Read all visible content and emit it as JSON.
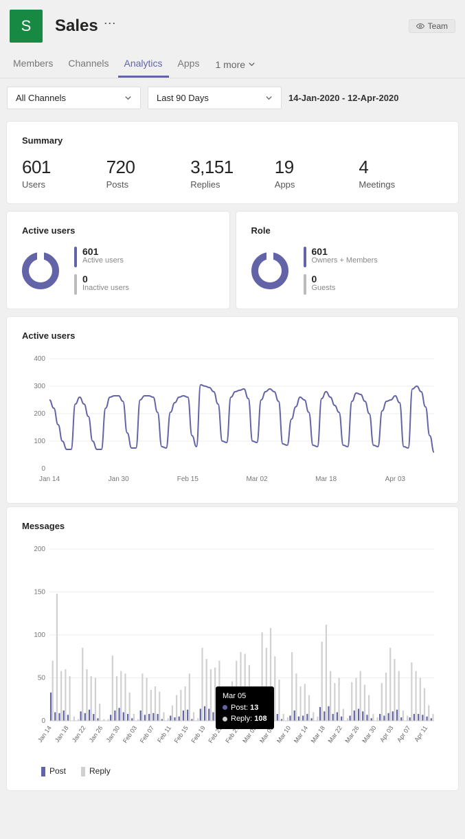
{
  "header": {
    "badge_letter": "S",
    "title": "Sales",
    "team_chip": "Team"
  },
  "tabs": {
    "items": [
      "Members",
      "Channels",
      "Analytics",
      "Apps"
    ],
    "active_index": 2,
    "more_label": "1 more"
  },
  "filters": {
    "channel_dropdown": "All Channels",
    "range_dropdown": "Last 90 Days",
    "date_range_text": "14-Jan-2020 - 12-Apr-2020"
  },
  "summary": {
    "title": "Summary",
    "stats": [
      {
        "value": "601",
        "label": "Users"
      },
      {
        "value": "720",
        "label": "Posts"
      },
      {
        "value": "3,151",
        "label": "Replies"
      },
      {
        "value": "19",
        "label": "Apps"
      },
      {
        "value": "4",
        "label": "Meetings"
      }
    ]
  },
  "active_users_card": {
    "title": "Active users",
    "primary_value": "601",
    "primary_label": "Active users",
    "secondary_value": "0",
    "secondary_label": "Inactive users"
  },
  "role_card": {
    "title": "Role",
    "primary_value": "601",
    "primary_label": "Owners + Members",
    "secondary_value": "0",
    "secondary_label": "Guests"
  },
  "active_users_chart_title": "Active users",
  "messages_chart_title": "Messages",
  "messages_legend": {
    "post": "Post",
    "reply": "Reply"
  },
  "tooltip": {
    "date": "Mar 05",
    "post_label": "Post",
    "post_value": "13",
    "reply_label": "Reply",
    "reply_value": "108"
  },
  "chart_data": [
    {
      "type": "line",
      "title": "Active users",
      "xlabel": "",
      "ylabel": "",
      "ylim": [
        0,
        400
      ],
      "x_tick_labels": [
        "Jan 14",
        "Jan 30",
        "Feb 15",
        "Mar 02",
        "Mar 18",
        "Apr 03"
      ],
      "x": [
        "Jan 14",
        "Jan 15",
        "Jan 16",
        "Jan 17",
        "Jan 18",
        "Jan 19",
        "Jan 20",
        "Jan 21",
        "Jan 22",
        "Jan 23",
        "Jan 24",
        "Jan 25",
        "Jan 26",
        "Jan 27",
        "Jan 28",
        "Jan 29",
        "Jan 30",
        "Jan 31",
        "Feb 01",
        "Feb 02",
        "Feb 03",
        "Feb 04",
        "Feb 05",
        "Feb 06",
        "Feb 07",
        "Feb 08",
        "Feb 09",
        "Feb 10",
        "Feb 11",
        "Feb 12",
        "Feb 13",
        "Feb 14",
        "Feb 15",
        "Feb 16",
        "Feb 17",
        "Feb 18",
        "Feb 19",
        "Feb 20",
        "Feb 21",
        "Feb 22",
        "Feb 23",
        "Feb 24",
        "Feb 25",
        "Feb 26",
        "Feb 27",
        "Feb 28",
        "Feb 29",
        "Mar 01",
        "Mar 02",
        "Mar 03",
        "Mar 04",
        "Mar 05",
        "Mar 06",
        "Mar 07",
        "Mar 08",
        "Mar 09",
        "Mar 10",
        "Mar 11",
        "Mar 12",
        "Mar 13",
        "Mar 14",
        "Mar 15",
        "Mar 16",
        "Mar 17",
        "Mar 18",
        "Mar 19",
        "Mar 20",
        "Mar 21",
        "Mar 22",
        "Mar 23",
        "Mar 24",
        "Mar 25",
        "Mar 26",
        "Mar 27",
        "Mar 28",
        "Mar 29",
        "Mar 30",
        "Mar 31",
        "Apr 01",
        "Apr 02",
        "Apr 03",
        "Apr 04",
        "Apr 05",
        "Apr 06",
        "Apr 07",
        "Apr 08",
        "Apr 09",
        "Apr 10",
        "Apr 11",
        "Apr 12"
      ],
      "values": [
        250,
        220,
        160,
        100,
        70,
        70,
        235,
        260,
        235,
        190,
        100,
        70,
        70,
        220,
        260,
        265,
        265,
        245,
        130,
        75,
        75,
        250,
        265,
        265,
        260,
        205,
        80,
        75,
        205,
        240,
        260,
        265,
        260,
        120,
        80,
        305,
        300,
        295,
        280,
        235,
        100,
        95,
        260,
        280,
        285,
        290,
        255,
        100,
        95,
        250,
        280,
        290,
        280,
        245,
        90,
        85,
        180,
        225,
        260,
        250,
        205,
        85,
        80,
        255,
        280,
        260,
        230,
        205,
        85,
        80,
        245,
        275,
        270,
        245,
        200,
        85,
        80,
        210,
        245,
        250,
        265,
        240,
        80,
        75,
        290,
        300,
        280,
        225,
        120,
        60
      ]
    },
    {
      "type": "bar",
      "title": "Messages",
      "xlabel": "",
      "ylabel": "",
      "ylim": [
        0,
        200
      ],
      "x_tick_labels": [
        "Jan 14",
        "Jan 18",
        "Jan 22",
        "Jan 26",
        "Jan 30",
        "Feb 03",
        "Feb 07",
        "Feb 11",
        "Feb 15",
        "Feb 19",
        "Feb 23",
        "Feb 27",
        "Mar 02",
        "Mar 06",
        "Mar 10",
        "Mar 14",
        "Mar 18",
        "Mar 22",
        "Mar 26",
        "Mar 30",
        "Apr 03",
        "Apr 07",
        "Apr 11"
      ],
      "categories": [
        "Jan 14",
        "Jan 15",
        "Jan 16",
        "Jan 17",
        "Jan 18",
        "Jan 19",
        "Jan 20",
        "Jan 21",
        "Jan 22",
        "Jan 23",
        "Jan 24",
        "Jan 25",
        "Jan 26",
        "Jan 27",
        "Jan 28",
        "Jan 29",
        "Jan 30",
        "Jan 31",
        "Feb 01",
        "Feb 02",
        "Feb 03",
        "Feb 04",
        "Feb 05",
        "Feb 06",
        "Feb 07",
        "Feb 08",
        "Feb 09",
        "Feb 10",
        "Feb 11",
        "Feb 12",
        "Feb 13",
        "Feb 14",
        "Feb 15",
        "Feb 16",
        "Feb 17",
        "Feb 18",
        "Feb 19",
        "Feb 20",
        "Feb 21",
        "Feb 22",
        "Feb 23",
        "Feb 24",
        "Feb 25",
        "Feb 26",
        "Feb 27",
        "Feb 28",
        "Feb 29",
        "Mar 01",
        "Mar 02",
        "Mar 03",
        "Mar 04",
        "Mar 05",
        "Mar 06",
        "Mar 07",
        "Mar 08",
        "Mar 09",
        "Mar 10",
        "Mar 11",
        "Mar 12",
        "Mar 13",
        "Mar 14",
        "Mar 15",
        "Mar 16",
        "Mar 17",
        "Mar 18",
        "Mar 19",
        "Mar 20",
        "Mar 21",
        "Mar 22",
        "Mar 23",
        "Mar 24",
        "Mar 25",
        "Mar 26",
        "Mar 27",
        "Mar 28",
        "Mar 29",
        "Mar 30",
        "Mar 31",
        "Apr 01",
        "Apr 02",
        "Apr 03",
        "Apr 04",
        "Apr 05",
        "Apr 06",
        "Apr 07",
        "Apr 08",
        "Apr 09",
        "Apr 10",
        "Apr 11",
        "Apr 12"
      ],
      "series": [
        {
          "name": "Post",
          "values": [
            33,
            10,
            9,
            12,
            7,
            0,
            0,
            11,
            9,
            13,
            8,
            3,
            0,
            0,
            7,
            12,
            15,
            10,
            8,
            3,
            0,
            12,
            7,
            8,
            9,
            8,
            2,
            0,
            6,
            4,
            5,
            12,
            13,
            2,
            0,
            14,
            17,
            14,
            10,
            7,
            3,
            0,
            4,
            7,
            13,
            16,
            12,
            3,
            0,
            7,
            6,
            13,
            16,
            8,
            2,
            0,
            6,
            12,
            5,
            6,
            8,
            3,
            0,
            16,
            11,
            17,
            8,
            10,
            5,
            0,
            6,
            12,
            14,
            11,
            7,
            3,
            0,
            8,
            6,
            9,
            11,
            13,
            4,
            0,
            4,
            8,
            8,
            7,
            5,
            3
          ]
        },
        {
          "name": "Reply",
          "values": [
            70,
            148,
            58,
            60,
            52,
            5,
            2,
            85,
            60,
            52,
            50,
            20,
            2,
            2,
            76,
            52,
            58,
            55,
            33,
            8,
            2,
            55,
            50,
            36,
            40,
            34,
            10,
            3,
            18,
            30,
            36,
            40,
            55,
            10,
            3,
            85,
            72,
            60,
            62,
            70,
            8,
            4,
            46,
            70,
            80,
            78,
            65,
            10,
            4,
            103,
            85,
            108,
            75,
            48,
            8,
            4,
            80,
            55,
            40,
            43,
            30,
            10,
            5,
            92,
            112,
            58,
            44,
            50,
            14,
            3,
            45,
            50,
            58,
            42,
            30,
            8,
            4,
            44,
            56,
            85,
            72,
            58,
            12,
            6,
            68,
            58,
            50,
            38,
            18,
            8
          ]
        }
      ],
      "tooltip": {
        "category": "Mar 05",
        "Post": 13,
        "Reply": 108
      }
    }
  ]
}
